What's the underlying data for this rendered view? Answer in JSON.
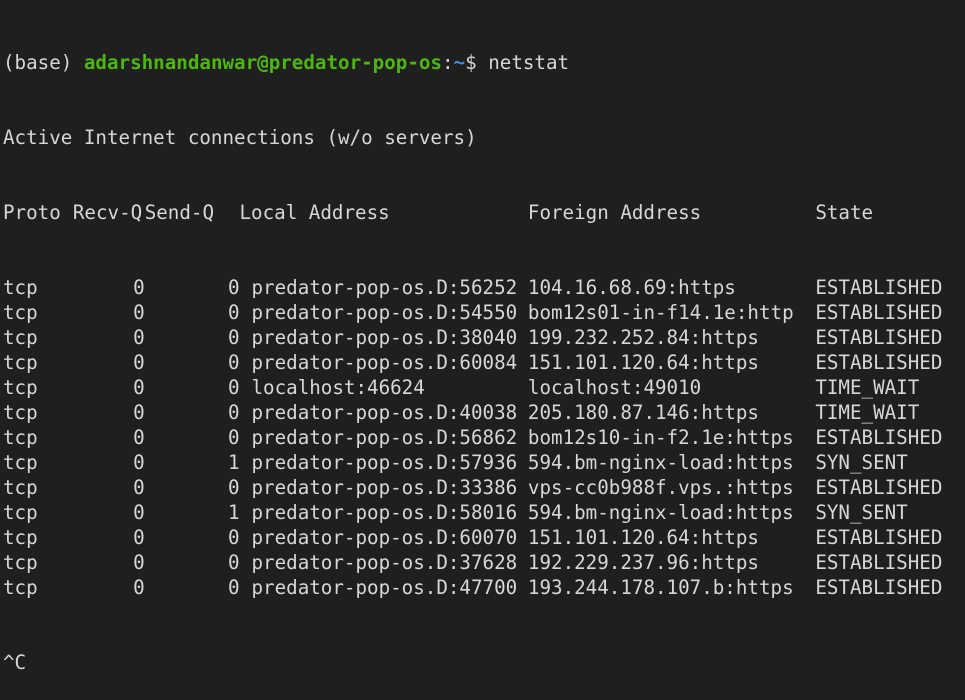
{
  "prompt": {
    "env": "(base) ",
    "user_host": "adarshnandanwar@predator-pop-os",
    "colon": ":",
    "path": "~",
    "symbol": "$ ",
    "command": "netstat"
  },
  "title_line": "Active Internet connections (w/o servers)",
  "headers": {
    "proto": "Proto",
    "recv_q": "Recv-Q",
    "send_q": "Send-Q",
    "local": "Local Address",
    "foreign": "Foreign Address",
    "state": "State"
  },
  "rows": [
    {
      "proto": "tcp",
      "recv_q": "0",
      "send_q": "0",
      "local": "predator-pop-os.D:56252",
      "foreign": "104.16.68.69:https",
      "state": "ESTABLISHED"
    },
    {
      "proto": "tcp",
      "recv_q": "0",
      "send_q": "0",
      "local": "predator-pop-os.D:54550",
      "foreign": "bom12s01-in-f14.1e:http",
      "state": "ESTABLISHED"
    },
    {
      "proto": "tcp",
      "recv_q": "0",
      "send_q": "0",
      "local": "predator-pop-os.D:38040",
      "foreign": "199.232.252.84:https",
      "state": "ESTABLISHED"
    },
    {
      "proto": "tcp",
      "recv_q": "0",
      "send_q": "0",
      "local": "predator-pop-os.D:60084",
      "foreign": "151.101.120.64:https",
      "state": "ESTABLISHED"
    },
    {
      "proto": "tcp",
      "recv_q": "0",
      "send_q": "0",
      "local": "localhost:46624",
      "foreign": "localhost:49010",
      "state": "TIME_WAIT"
    },
    {
      "proto": "tcp",
      "recv_q": "0",
      "send_q": "0",
      "local": "predator-pop-os.D:40038",
      "foreign": "205.180.87.146:https",
      "state": "TIME_WAIT"
    },
    {
      "proto": "tcp",
      "recv_q": "0",
      "send_q": "0",
      "local": "predator-pop-os.D:56862",
      "foreign": "bom12s10-in-f2.1e:https",
      "state": "ESTABLISHED"
    },
    {
      "proto": "tcp",
      "recv_q": "0",
      "send_q": "1",
      "local": "predator-pop-os.D:57936",
      "foreign": "594.bm-nginx-load:https",
      "state": "SYN_SENT"
    },
    {
      "proto": "tcp",
      "recv_q": "0",
      "send_q": "0",
      "local": "predator-pop-os.D:33386",
      "foreign": "vps-cc0b988f.vps.:https",
      "state": "ESTABLISHED"
    },
    {
      "proto": "tcp",
      "recv_q": "0",
      "send_q": "1",
      "local": "predator-pop-os.D:58016",
      "foreign": "594.bm-nginx-load:https",
      "state": "SYN_SENT"
    },
    {
      "proto": "tcp",
      "recv_q": "0",
      "send_q": "0",
      "local": "predator-pop-os.D:60070",
      "foreign": "151.101.120.64:https",
      "state": "ESTABLISHED"
    },
    {
      "proto": "tcp",
      "recv_q": "0",
      "send_q": "0",
      "local": "predator-pop-os.D:37628",
      "foreign": "192.229.237.96:https",
      "state": "ESTABLISHED"
    },
    {
      "proto": "tcp",
      "recv_q": "0",
      "send_q": "0",
      "local": "predator-pop-os.D:47700",
      "foreign": "193.244.178.107.b:https",
      "state": "ESTABLISHED"
    }
  ],
  "interrupt": "^C",
  "colors": {
    "background": "#1f1f1f",
    "text": "#d7d7d7",
    "prompt_user": "#4db70f",
    "prompt_path": "#3b8eea"
  }
}
